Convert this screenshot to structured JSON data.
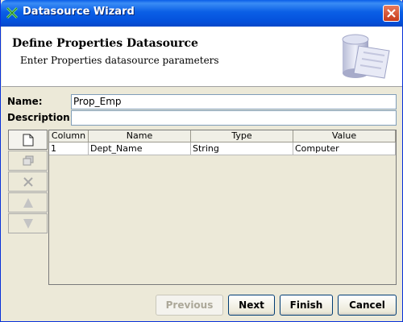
{
  "window": {
    "title": "Datasource Wizard"
  },
  "header": {
    "title": "Define Properties Datasource",
    "subtitle": "Enter Properties datasource parameters"
  },
  "form": {
    "name_label": "Name:",
    "name_value": "Prop_Emp",
    "description_label": "Description:",
    "description_value": ""
  },
  "toolbar": {
    "items": [
      "new-row-icon",
      "copy-row-icon",
      "delete-row-icon",
      "move-up-icon",
      "move-down-icon"
    ]
  },
  "table": {
    "columns": [
      "Column",
      "Name",
      "Type",
      "Value"
    ],
    "rows": [
      [
        "1",
        "Dept_Name",
        "String",
        "Computer"
      ]
    ]
  },
  "buttons": {
    "previous": "Previous",
    "next": "Next",
    "finish": "Finish",
    "cancel": "Cancel"
  }
}
